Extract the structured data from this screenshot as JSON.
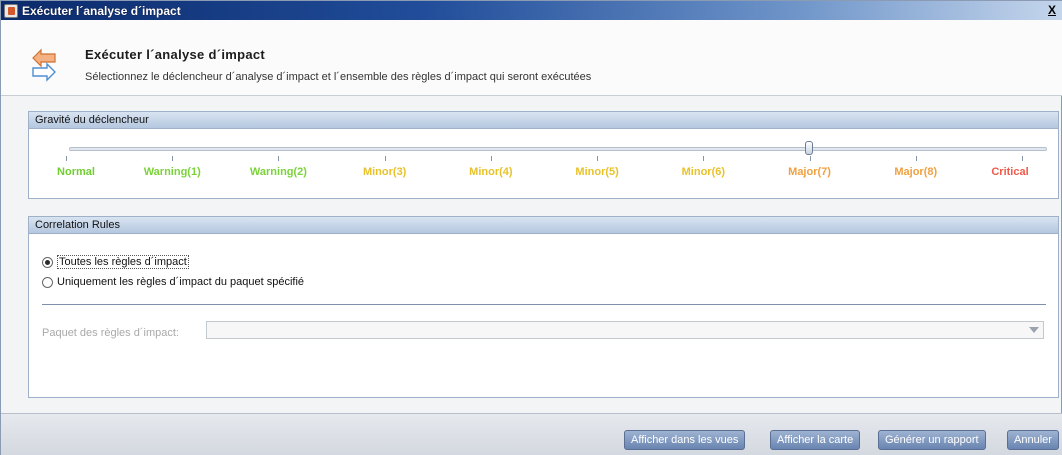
{
  "window": {
    "title": "Exécuter l´analyse d´impact",
    "close_label": "X"
  },
  "header": {
    "title": "Exécuter l´analyse d´impact",
    "subtitle": "Sélectionnez le déclencheur d´analyse d´impact et l´ensemble des règles d´impact qui seront exécutées"
  },
  "gravity": {
    "panel_title": "Gravité du déclencheur",
    "selected_level": "Major(7)",
    "levels": [
      {
        "label": "Normal",
        "color": "#6fcf2e"
      },
      {
        "label": "Warning(1)",
        "color": "#7bd33a"
      },
      {
        "label": "Warning(2)",
        "color": "#7bd33a"
      },
      {
        "label": "Minor(3)",
        "color": "#e8c22a"
      },
      {
        "label": "Minor(4)",
        "color": "#e8c22a"
      },
      {
        "label": "Minor(5)",
        "color": "#e8c22a"
      },
      {
        "label": "Minor(6)",
        "color": "#e8c22a"
      },
      {
        "label": "Major(7)",
        "color": "#f0a040"
      },
      {
        "label": "Major(8)",
        "color": "#f0a040"
      },
      {
        "label": "Critical",
        "color": "#f05a4a"
      }
    ]
  },
  "rules": {
    "panel_title": "Correlation Rules",
    "option_all": "Toutes les règles d´impact",
    "option_package": "Uniquement les règles d´impact du paquet spécifié",
    "selected": "all",
    "package_label": "Paquet des règles d´impact:",
    "package_value": ""
  },
  "footer": {
    "btn_views": "Afficher dans les vues",
    "btn_map": "Afficher la carte",
    "btn_report": "Générer un rapport",
    "btn_cancel": "Annuler"
  }
}
